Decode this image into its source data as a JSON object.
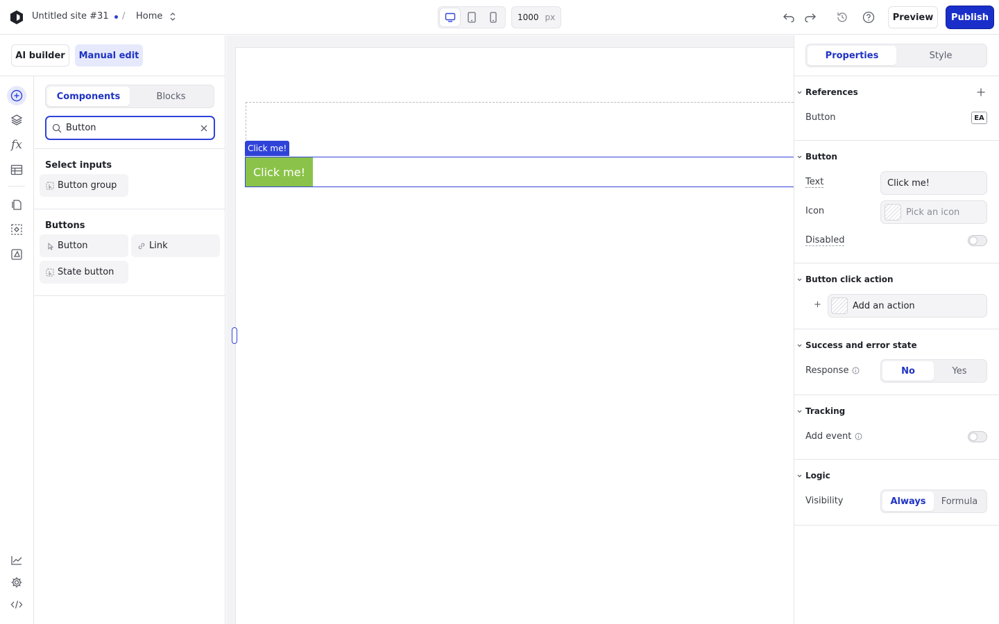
{
  "topbar": {
    "site_name": "Untitled site #31",
    "separator": "/",
    "page": "Home",
    "width_value": "1000",
    "width_unit": "px",
    "preview": "Preview",
    "publish": "Publish"
  },
  "mode": {
    "ai_builder": "AI builder",
    "manual_edit": "Manual edit"
  },
  "components_panel": {
    "tabs": [
      {
        "label": "Components",
        "active": true
      },
      {
        "label": "Blocks",
        "active": false
      }
    ],
    "search_value": "Button",
    "sections": [
      {
        "title": "Select inputs",
        "items": [
          {
            "label": "Button group",
            "icon": "button-group-icon"
          }
        ]
      },
      {
        "title": "Buttons",
        "items": [
          {
            "label": "Button",
            "icon": "button-cursor-icon"
          },
          {
            "label": "Link",
            "icon": "link-icon"
          },
          {
            "label": "State button",
            "icon": "state-button-icon"
          }
        ]
      }
    ]
  },
  "canvas": {
    "selection_tag": "Click me!",
    "button_text": "Click me!",
    "button_color": "#8bc34a",
    "selection_color": "#2f43d8"
  },
  "properties": {
    "tabs": [
      {
        "label": "Properties",
        "active": true
      },
      {
        "label": "Style",
        "active": false
      }
    ],
    "references": {
      "title": "References",
      "item": "Button",
      "badge": "EA"
    },
    "button": {
      "title": "Button",
      "text_label": "Text",
      "text_value": "Click me!",
      "icon_label": "Icon",
      "icon_placeholder": "Pick an icon",
      "disabled_label": "Disabled",
      "disabled": false
    },
    "click_action": {
      "title": "Button click action",
      "plus": "+",
      "add_action": "Add an action"
    },
    "success_error": {
      "title": "Success and error state",
      "response_label": "Response",
      "options": [
        "No",
        "Yes"
      ],
      "selected": "No"
    },
    "tracking": {
      "title": "Tracking",
      "add_event_label": "Add event",
      "enabled": false
    },
    "logic": {
      "title": "Logic",
      "visibility_label": "Visibility",
      "options": [
        "Always",
        "Formula"
      ],
      "selected": "Always"
    }
  },
  "colors": {
    "accent": "#1f33c4",
    "publish": "#1a2fc9",
    "accent_bg": "#e6e9fb"
  }
}
